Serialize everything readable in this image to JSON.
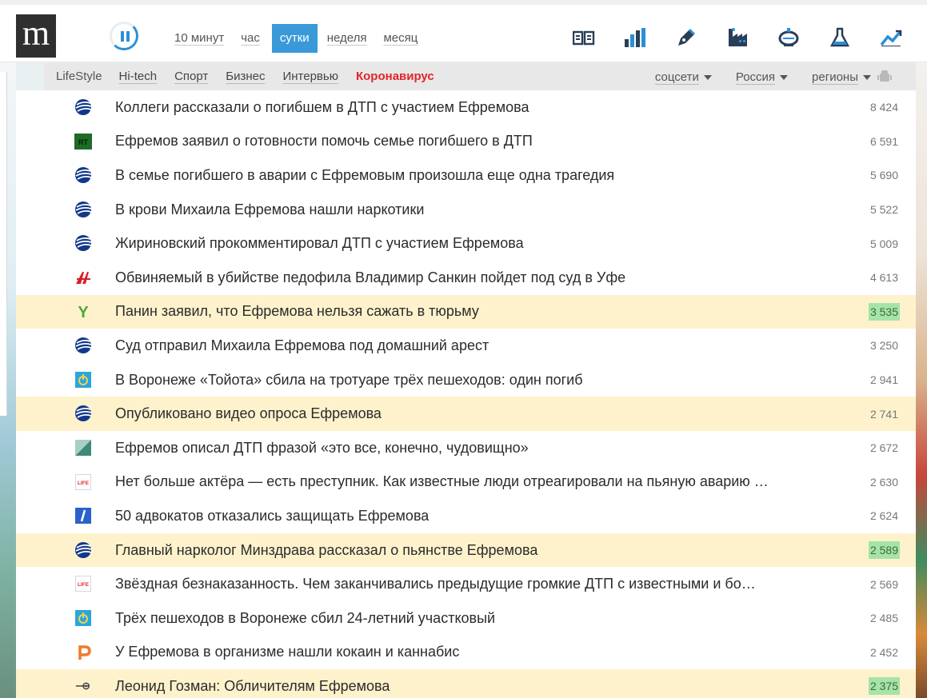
{
  "header": {
    "logo_text": "m",
    "periods": [
      {
        "label": "10 минут",
        "active": false
      },
      {
        "label": "час",
        "active": false
      },
      {
        "label": "сутки",
        "active": true
      },
      {
        "label": "неделя",
        "active": false
      },
      {
        "label": "месяц",
        "active": false
      }
    ],
    "category_icons": [
      "book-icon",
      "bar-chart-icon",
      "pen-icon",
      "factory-icon",
      "cup-icon",
      "flask-icon",
      "line-chart-icon"
    ],
    "accent_color": "#3a9ad9"
  },
  "subnav": {
    "tabs": [
      "LifeStyle",
      "Hi-tech",
      "Спорт",
      "Бизнес",
      "Интервью",
      "Коронавирус"
    ],
    "filters": [
      "соцсети",
      "Россия",
      "регионы"
    ],
    "hot_tab_color": "#e4242a"
  },
  "news": [
    {
      "title": "Коллеги рассказали о погибшем в ДТП с участием Ефремова",
      "count": "8 424",
      "source": "globe-icon",
      "highlight": false,
      "hot": false
    },
    {
      "title": "Ефремов заявил о готовности помочь семье погибшего в ДТП",
      "count": "6 591",
      "source": "rt-icon",
      "highlight": false,
      "hot": false
    },
    {
      "title": "В семье погибшего в аварии с Ефремовым произошла еще одна трагедия",
      "count": "5 690",
      "source": "globe-icon",
      "highlight": false,
      "hot": false
    },
    {
      "title": "В крови Михаила Ефремова нашли наркотики",
      "count": "5 522",
      "source": "globe-icon",
      "highlight": false,
      "hot": false
    },
    {
      "title": "Жириновский прокомментировал ДТП с участием Ефремова",
      "count": "5 009",
      "source": "globe-icon",
      "highlight": false,
      "hot": false
    },
    {
      "title": "Обвиняемый в убийстве педофила Владимир Санкин пойдет под суд в Уфе",
      "count": "4 613",
      "source": "red-a-icon",
      "highlight": false,
      "hot": false
    },
    {
      "title": "Панин заявил, что Ефремова нельзя сажать в тюрьму",
      "count": "3 535",
      "source": "y-icon",
      "highlight": true,
      "hot": true
    },
    {
      "title": "Суд отправил Михаила Ефремова под домашний арест",
      "count": "3 250",
      "source": "globe-icon",
      "highlight": false,
      "hot": false
    },
    {
      "title": "В Воронеже «Тойота» сбила на тротуаре трёх пешеходов: один погиб",
      "count": "2 941",
      "source": "power-icon",
      "highlight": false,
      "hot": false
    },
    {
      "title": "Опубликовано видео опроса Ефремова",
      "count": "2 741",
      "source": "globe-icon",
      "highlight": true,
      "hot": false
    },
    {
      "title": "Ефремов описал ДТП фразой «это все, конечно, чудовищно»",
      "count": "2 672",
      "source": "diagonal-icon",
      "highlight": false,
      "hot": false
    },
    {
      "title": "Нет больше актёра — есть преступник. Как известные люди отреагировали на пьяную аварию …",
      "count": "2 630",
      "source": "life-icon",
      "highlight": false,
      "hot": false
    },
    {
      "title": "50 адвокатов отказались защищать Ефремова",
      "count": "2 624",
      "source": "slash-icon",
      "highlight": false,
      "hot": false
    },
    {
      "title": "Главный нарколог Минздрава рассказал о пьянстве Ефремова",
      "count": "2 589",
      "source": "globe-icon",
      "highlight": true,
      "hot": true
    },
    {
      "title": "Звёздная безнаказанность. Чем заканчивались предыдущие громкие ДТП с известными и бо…",
      "count": "2 569",
      "source": "life-icon",
      "highlight": false,
      "hot": false
    },
    {
      "title": "Трёх пешеходов в Воронеже сбил 24-летний участковый",
      "count": "2 485",
      "source": "power-icon",
      "highlight": false,
      "hot": false
    },
    {
      "title": "У Ефремова в организме нашли кокаин и каннабис",
      "count": "2 452",
      "source": "p-icon",
      "highlight": false,
      "hot": false
    },
    {
      "title": "Леонид Гозман: Обличителям Ефремова",
      "count": "2 375",
      "source": "echo-icon",
      "highlight": true,
      "hot": true
    }
  ]
}
